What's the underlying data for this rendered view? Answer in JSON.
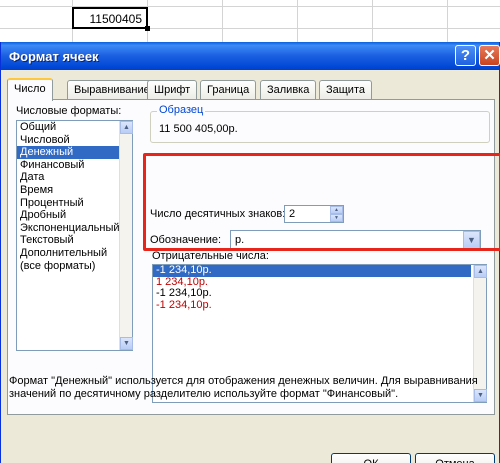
{
  "sheet": {
    "cell_value": "11500405"
  },
  "dialog": {
    "title": "Формат ячеек",
    "help_glyph": "?",
    "close_glyph": "✕",
    "tabs": [
      "Число",
      "Выравнивание",
      "Шрифт",
      "Граница",
      "Заливка",
      "Защита"
    ],
    "active_tab": "Число",
    "number_formats_label": "Числовые форматы:",
    "categories": [
      "Общий",
      "Числовой",
      "Денежный",
      "Финансовый",
      "Дата",
      "Время",
      "Процентный",
      "Дробный",
      "Экспоненциальный",
      "Текстовый",
      "Дополнительный",
      "(все форматы)"
    ],
    "selected_category": "Денежный",
    "sample": {
      "label": "Образец",
      "value": "11 500 405,00р."
    },
    "decimals": {
      "label": "Число десятичных знаков:",
      "value": "2"
    },
    "symbol": {
      "label": "Обозначение:",
      "value": "р."
    },
    "negative_numbers": {
      "label": "Отрицательные числа:",
      "items": [
        {
          "text": "-1 234,10р.",
          "color": "#ffffff",
          "selected": true
        },
        {
          "text": "1 234,10р.",
          "color": "#c00000",
          "selected": false
        },
        {
          "text": "-1 234,10р.",
          "color": "#000000",
          "selected": false
        },
        {
          "text": "-1 234,10р.",
          "color": "#c00000",
          "selected": false
        }
      ]
    },
    "description": "Формат \"Денежный\" используется для отображения денежных величин. Для выравнивания значений по десятичному разделителю используйте формат \"Финансовый\".",
    "buttons": {
      "ok": "ОК",
      "cancel": "Отмена"
    },
    "colors": {
      "titlebar": "#0a5fdf",
      "selection": "#316ac5",
      "highlight_frame": "#e8251a"
    }
  }
}
